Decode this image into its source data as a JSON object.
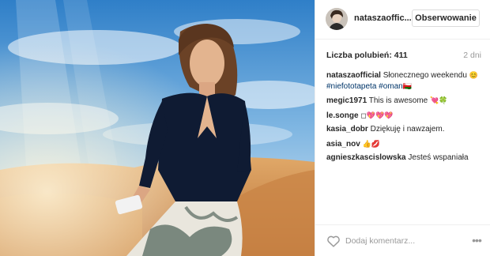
{
  "post": {
    "photo_alt": "post-photo",
    "author": "nataszaofficial",
    "author_short": "nataszaoffic...",
    "follow_label": "Obserwowanie",
    "likes_label": "Liczba polubień: 411",
    "time_label": "2 dni",
    "caption": {
      "user": "nataszaofficial",
      "text": " Słonecznego weekendu ",
      "emoji_1": "😊",
      "hashtag_1": "#niefototapeta",
      "hashtag_2": "#oman",
      "emoji_2": "🇴🇲"
    }
  },
  "comments": [
    {
      "user": "megic1971",
      "text": " This is awesome ",
      "emoji": "💘🍀"
    },
    {
      "user": "le.songe",
      "text": " ",
      "emoji": "◻💖💖💖"
    },
    {
      "user": "kasia_dobr",
      "text": " Dziękuję i nawzajem.",
      "emoji": ""
    },
    {
      "user": "asia_nov",
      "text": " ",
      "emoji": "👍💋"
    },
    {
      "user": "agnieszkascislowska",
      "text": " Jesteś wspaniała",
      "emoji": ""
    }
  ],
  "actions": {
    "comment_placeholder": "Dodaj komentarz...",
    "more_label": "•••"
  },
  "colors": {
    "hashtag": "#003569",
    "border": "#efefef",
    "muted": "#999999"
  }
}
